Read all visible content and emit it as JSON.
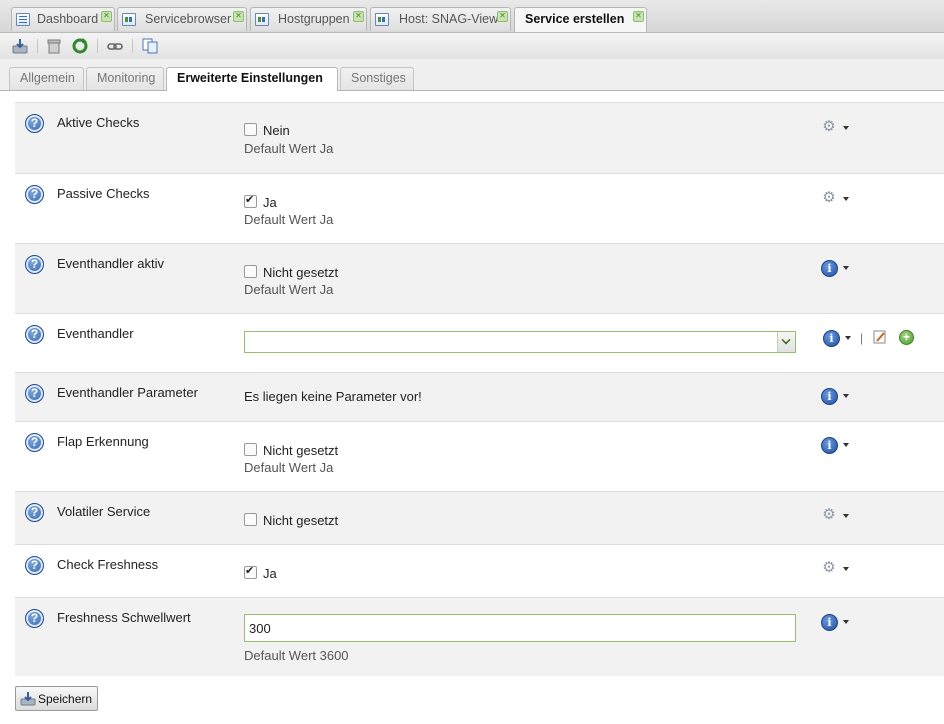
{
  "tabs": [
    {
      "label": "Dashboard",
      "icon": "list-icon"
    },
    {
      "label": "Servicebrowser",
      "icon": "grid-icon"
    },
    {
      "label": "Hostgruppen",
      "icon": "grid-icon"
    },
    {
      "label": "Host: SNAG-View",
      "icon": "grid-icon"
    },
    {
      "label": "Service erstellen",
      "active": true
    }
  ],
  "subtabs": [
    {
      "label": "Allgemein"
    },
    {
      "label": "Monitoring"
    },
    {
      "label": "Erweiterte Einstellungen",
      "active": true
    },
    {
      "label": "Sonstiges"
    }
  ],
  "rows": [
    {
      "label": "Aktive Checks",
      "value": "Nein",
      "checked": false,
      "default": "Default Wert Ja",
      "action_icon": "gear"
    },
    {
      "label": "Passive Checks",
      "value": "Ja",
      "checked": true,
      "default": "Default Wert Ja",
      "action_icon": "gear"
    },
    {
      "label": "Eventhandler aktiv",
      "value": "Nicht gesetzt",
      "checked": false,
      "default": "Default Wert Ja",
      "action_icon": "info"
    },
    {
      "label": "Eventhandler",
      "select_value": "",
      "action_icon": "info"
    },
    {
      "label": "Eventhandler Parameter",
      "text": "Es liegen keine Parameter vor!",
      "action_icon": "info"
    },
    {
      "label": "Flap Erkennung",
      "value": "Nicht gesetzt",
      "checked": false,
      "default": "Default Wert Ja",
      "action_icon": "info"
    },
    {
      "label": "Volatiler Service",
      "value": "Nicht gesetzt",
      "checked": false,
      "action_icon": "gear"
    },
    {
      "label": "Check Freshness",
      "value": "Ja",
      "checked": true,
      "action_icon": "gear"
    },
    {
      "label": "Freshness Schwellwert",
      "input_value": "300",
      "default": "Default Wert 3600",
      "action_icon": "info"
    }
  ],
  "save_label": "Speichern"
}
